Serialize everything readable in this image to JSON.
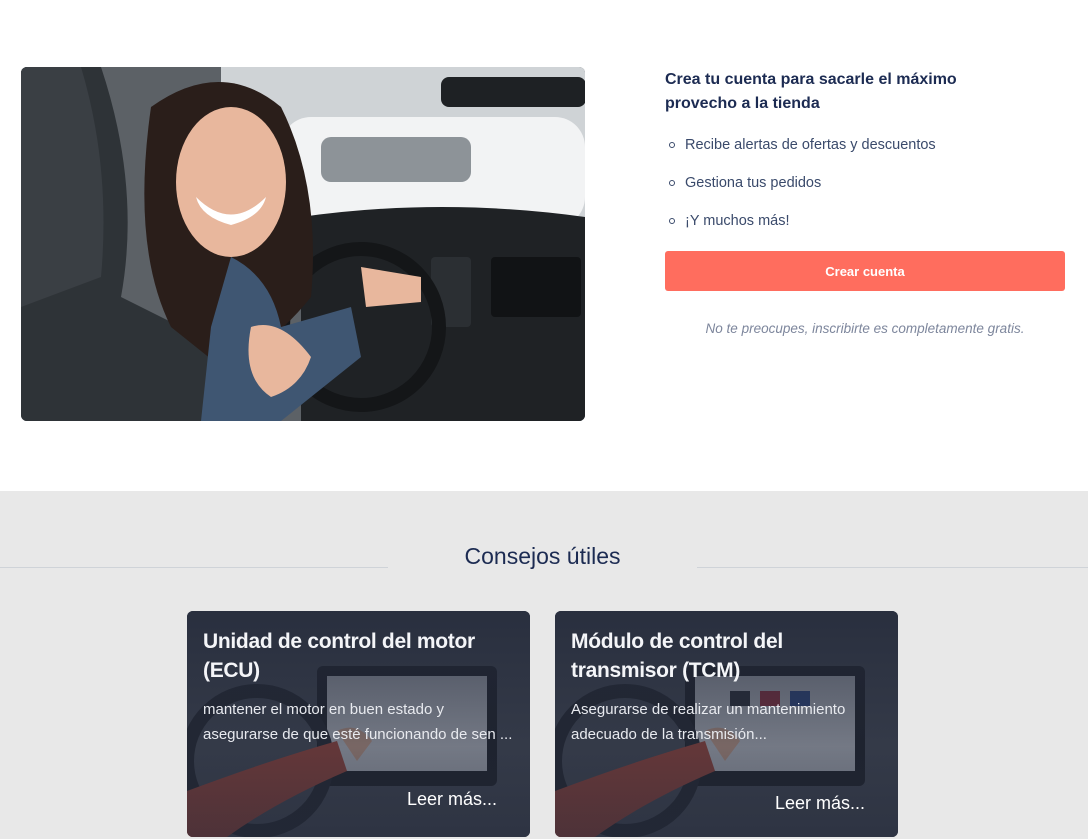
{
  "signup": {
    "title": "Crea tu cuenta para sacarle el máximo provecho a la tienda",
    "benefits": [
      "Recibe alertas de ofertas y descuentos",
      "Gestiona tus pedidos",
      "¡Y muchos más!"
    ],
    "button_label": "Crear cuenta",
    "note": "No te preocupes, inscribirte es completamente gratis."
  },
  "tips": {
    "title": "Consejos útiles",
    "cards": [
      {
        "title": "Unidad de control del motor (ECU)",
        "text": "mantener el motor en buen estado y asegurarse de que esté funcionando de sen ...",
        "link": "Leer más..."
      },
      {
        "title": "Módulo de control del transmisor (TCM)",
        "text": "Asegurarse de realizar un mantenimiento adecuado de la transmisión...",
        "link": "Leer más..."
      }
    ]
  },
  "colors": {
    "accent": "#ff6d5e",
    "navy": "#1c2b52",
    "tips_background": "#e8e8e8"
  }
}
